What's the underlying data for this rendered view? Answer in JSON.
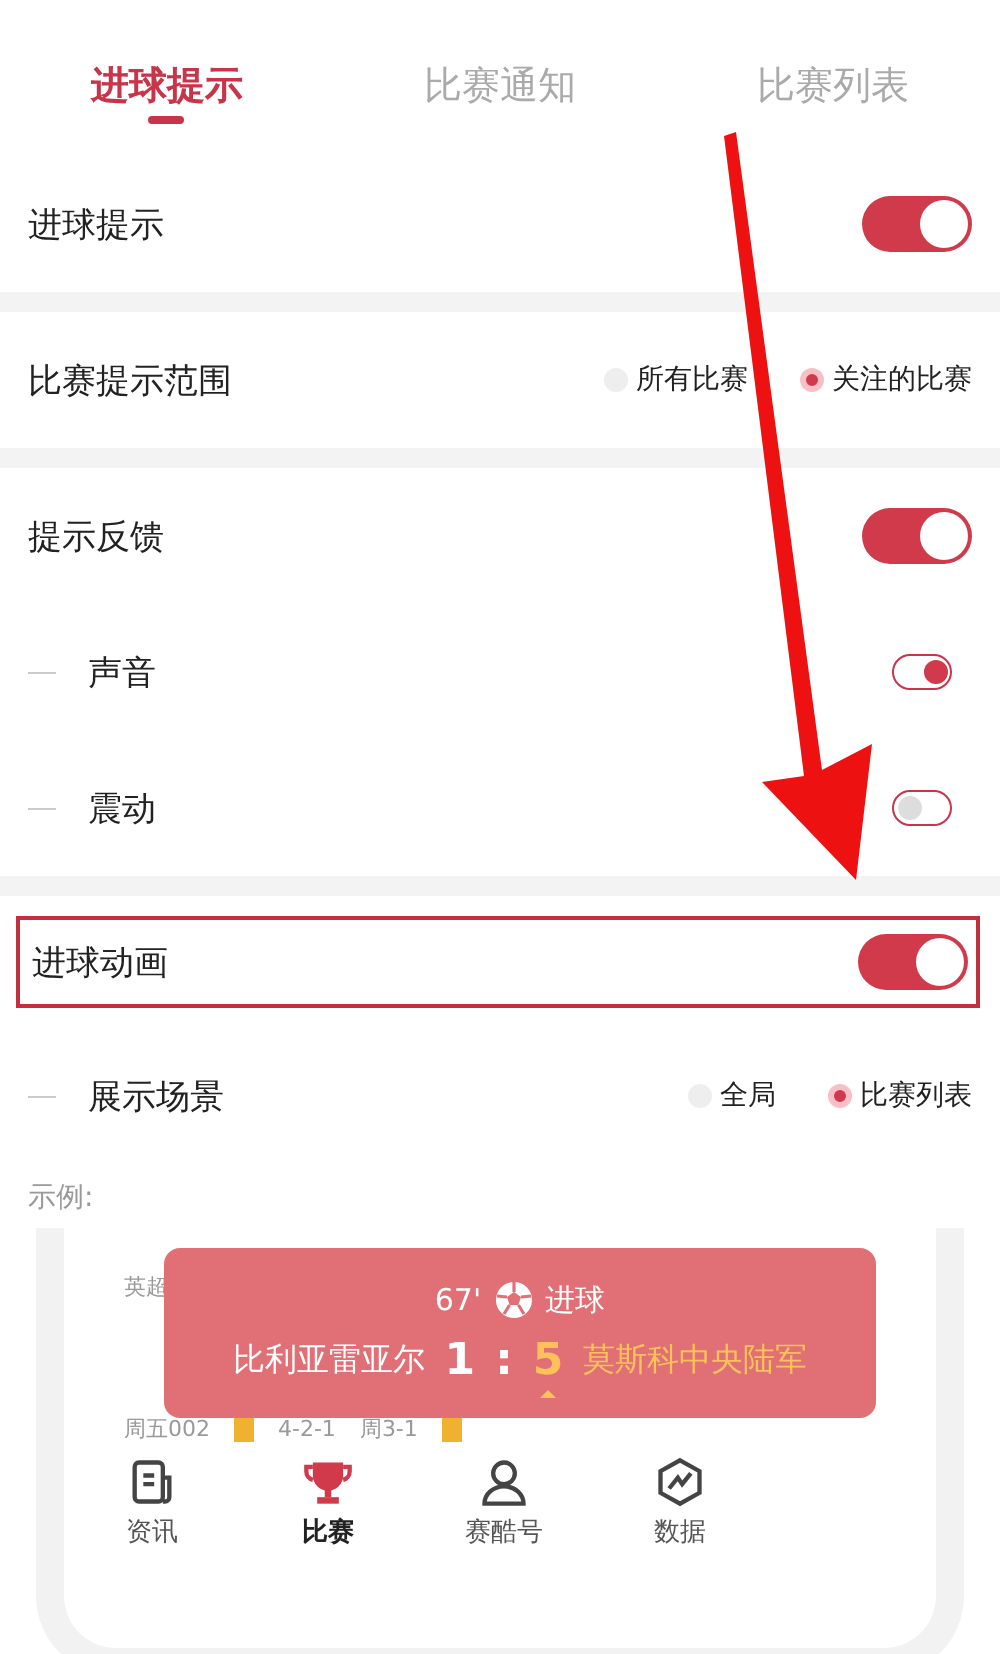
{
  "tabs": [
    {
      "label": "进球提示",
      "selected": true
    },
    {
      "label": "比赛通知",
      "selected": false
    },
    {
      "label": "比赛列表",
      "selected": false
    }
  ],
  "sections": [
    {
      "rows": [
        {
          "kind": "toggle",
          "label": "进球提示",
          "on": true,
          "sub": false,
          "highlighted": false
        }
      ]
    },
    {
      "rows": [
        {
          "kind": "radio",
          "label": "比赛提示范围",
          "sub": false,
          "highlighted": false,
          "options": [
            {
              "label": "所有比赛",
              "selected": false
            },
            {
              "label": "关注的比赛",
              "selected": true
            }
          ]
        }
      ]
    },
    {
      "rows": [
        {
          "kind": "toggle",
          "label": "提示反馈",
          "on": true,
          "sub": false,
          "highlighted": false
        },
        {
          "kind": "toggle",
          "label": "声音",
          "on": true,
          "sub": true,
          "highlighted": false
        },
        {
          "kind": "toggle",
          "label": "震动",
          "on": false,
          "sub": true,
          "highlighted": false
        }
      ]
    },
    {
      "rows": [
        {
          "kind": "toggle",
          "label": "进球动画",
          "on": true,
          "sub": false,
          "highlighted": true
        },
        {
          "kind": "radio",
          "label": "展示场景",
          "sub": true,
          "highlighted": false,
          "options": [
            {
              "label": "全局",
              "selected": false
            },
            {
              "label": "比赛列表",
              "selected": true
            }
          ]
        }
      ]
    }
  ],
  "example": {
    "label": "示例:",
    "background": {
      "league": "英超",
      "date": "周五002",
      "odds": "4-2-1",
      "history": "周3-1"
    },
    "popup": {
      "minute": "67'",
      "event": "进球",
      "home": "比利亚雷亚尔",
      "home_score": "1",
      "separator": ":",
      "away_score": "5",
      "away": "莫斯科中央陆军"
    },
    "nav": [
      {
        "label": "资讯",
        "selected": false
      },
      {
        "label": "比赛",
        "selected": true
      },
      {
        "label": "赛酷号",
        "selected": false
      },
      {
        "label": "数据",
        "selected": false
      }
    ]
  }
}
